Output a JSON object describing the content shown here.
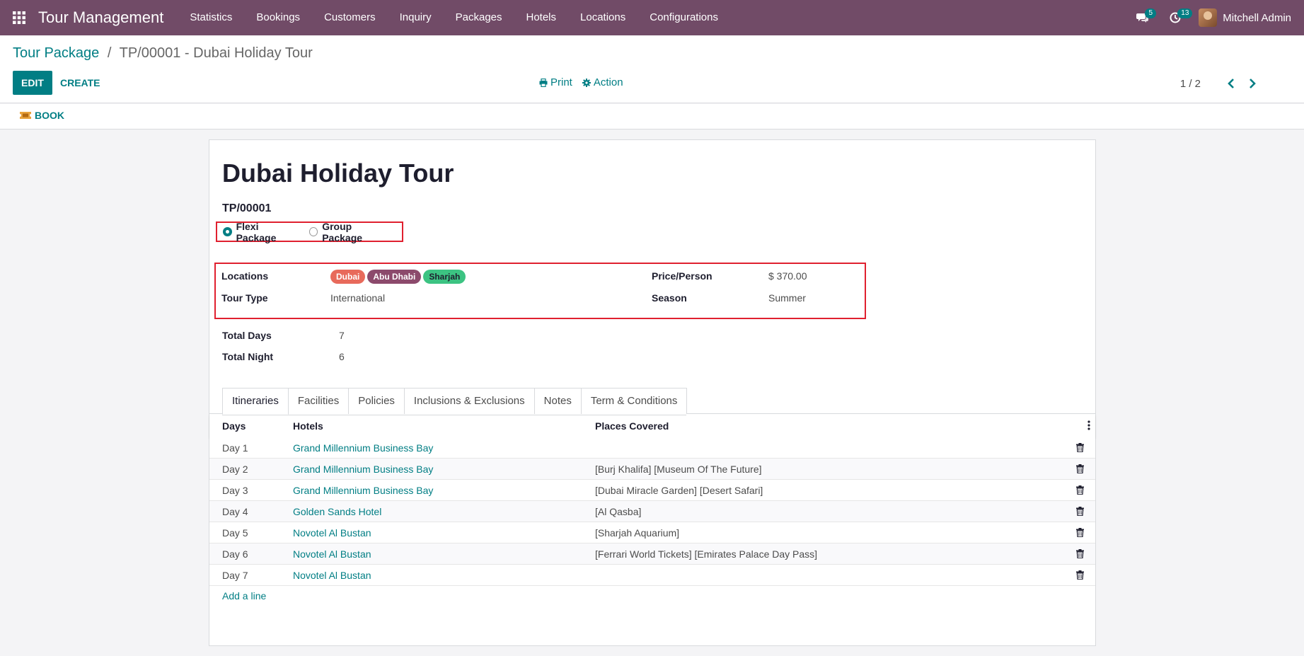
{
  "app": {
    "title": "Tour Management",
    "menu": [
      "Statistics",
      "Bookings",
      "Customers",
      "Inquiry",
      "Packages",
      "Hotels",
      "Locations",
      "Configurations"
    ],
    "messages_count": "5",
    "activities_count": "13",
    "user_name": "Mitchell Admin"
  },
  "breadcrumb": {
    "parent": "Tour Package",
    "separator": "/",
    "current": "TP/00001 - Dubai Holiday Tour"
  },
  "toolbar": {
    "edit_label": "EDIT",
    "create_label": "CREATE",
    "print_label": "Print",
    "action_label": "Action",
    "pager_value": "1 / 2"
  },
  "statusbar": {
    "book_label": "BOOK"
  },
  "record": {
    "name": "Dubai Holiday Tour",
    "reference": "TP/00001",
    "package_options": [
      {
        "label": "Flexi Package",
        "selected": true
      },
      {
        "label": "Group Package",
        "selected": false
      }
    ],
    "locations_label": "Locations",
    "locations": [
      {
        "name": "Dubai",
        "color": "#e86a5b"
      },
      {
        "name": "Abu Dhabi",
        "color": "#8c4a6c"
      },
      {
        "name": "Sharjah",
        "color": "#3cc382"
      }
    ],
    "tour_type_label": "Tour Type",
    "tour_type": "International",
    "price_label": "Price/Person",
    "price": "$ 370.00",
    "season_label": "Season",
    "season": "Summer",
    "total_days_label": "Total Days",
    "total_days": "7",
    "total_night_label": "Total Night",
    "total_night": "6"
  },
  "tabs": [
    "Itineraries",
    "Facilities",
    "Policies",
    "Inclusions & Exclusions",
    "Notes",
    "Term & Conditions"
  ],
  "itinerary": {
    "columns": [
      "Days",
      "Hotels",
      "Places Covered"
    ],
    "rows": [
      {
        "day": "Day 1",
        "hotel": "Grand Millennium Business Bay",
        "places": ""
      },
      {
        "day": "Day 2",
        "hotel": "Grand Millennium Business Bay",
        "places": "[Burj Khalifa] [Museum Of The Future]"
      },
      {
        "day": "Day 3",
        "hotel": "Grand Millennium Business Bay",
        "places": "[Dubai Miracle Garden] [Desert Safari]"
      },
      {
        "day": "Day 4",
        "hotel": "Golden Sands Hotel",
        "places": "[Al Qasba]"
      },
      {
        "day": "Day 5",
        "hotel": "Novotel Al Bustan",
        "places": "[Sharjah Aquarium]"
      },
      {
        "day": "Day 6",
        "hotel": "Novotel Al Bustan",
        "places": "[Ferrari World Tickets] [Emirates Palace Day Pass]"
      },
      {
        "day": "Day 7",
        "hotel": "Novotel Al Bustan",
        "places": ""
      }
    ],
    "add_line_label": "Add a line"
  },
  "colors": {
    "brand": "#714b67",
    "accent": "#017e84",
    "highlight_border": "#e0202f"
  }
}
